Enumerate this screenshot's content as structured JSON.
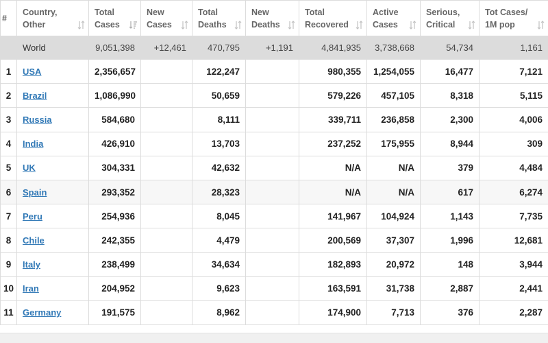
{
  "columns": [
    {
      "label": "#",
      "sortable": false
    },
    {
      "label": "Country,\nOther",
      "sortable": true
    },
    {
      "label": "Total\nCases",
      "sortable": true,
      "active": true
    },
    {
      "label": "New\nCases",
      "sortable": true
    },
    {
      "label": "Total\nDeaths",
      "sortable": true
    },
    {
      "label": "New\nDeaths",
      "sortable": true
    },
    {
      "label": "Total\nRecovered",
      "sortable": true
    },
    {
      "label": "Active\nCases",
      "sortable": true
    },
    {
      "label": "Serious,\nCritical",
      "sortable": true
    },
    {
      "label": "Tot Cases/\n1M pop",
      "sortable": true
    }
  ],
  "world": {
    "country": "World",
    "total_cases": "9,051,398",
    "new_cases": "+12,461",
    "total_deaths": "470,795",
    "new_deaths": "+1,191",
    "total_recovered": "4,841,935",
    "active_cases": "3,738,668",
    "serious_critical": "54,734",
    "cases_per_1m": "1,161"
  },
  "rows": [
    {
      "index": "1",
      "country": "USA",
      "total_cases": "2,356,657",
      "new_cases": "",
      "total_deaths": "122,247",
      "new_deaths": "",
      "total_recovered": "980,355",
      "active_cases": "1,254,055",
      "serious_critical": "16,477",
      "cases_per_1m": "7,121"
    },
    {
      "index": "2",
      "country": "Brazil",
      "total_cases": "1,086,990",
      "new_cases": "",
      "total_deaths": "50,659",
      "new_deaths": "",
      "total_recovered": "579,226",
      "active_cases": "457,105",
      "serious_critical": "8,318",
      "cases_per_1m": "5,115"
    },
    {
      "index": "3",
      "country": "Russia",
      "total_cases": "584,680",
      "new_cases": "",
      "total_deaths": "8,111",
      "new_deaths": "",
      "total_recovered": "339,711",
      "active_cases": "236,858",
      "serious_critical": "2,300",
      "cases_per_1m": "4,006"
    },
    {
      "index": "4",
      "country": "India",
      "total_cases": "426,910",
      "new_cases": "",
      "total_deaths": "13,703",
      "new_deaths": "",
      "total_recovered": "237,252",
      "active_cases": "175,955",
      "serious_critical": "8,944",
      "cases_per_1m": "309"
    },
    {
      "index": "5",
      "country": "UK",
      "total_cases": "304,331",
      "new_cases": "",
      "total_deaths": "42,632",
      "new_deaths": "",
      "total_recovered": "N/A",
      "active_cases": "N/A",
      "serious_critical": "379",
      "cases_per_1m": "4,484"
    },
    {
      "index": "6",
      "country": "Spain",
      "total_cases": "293,352",
      "new_cases": "",
      "total_deaths": "28,323",
      "new_deaths": "",
      "total_recovered": "N/A",
      "active_cases": "N/A",
      "serious_critical": "617",
      "cases_per_1m": "6,274"
    },
    {
      "index": "7",
      "country": "Peru",
      "total_cases": "254,936",
      "new_cases": "",
      "total_deaths": "8,045",
      "new_deaths": "",
      "total_recovered": "141,967",
      "active_cases": "104,924",
      "serious_critical": "1,143",
      "cases_per_1m": "7,735"
    },
    {
      "index": "8",
      "country": "Chile",
      "total_cases": "242,355",
      "new_cases": "",
      "total_deaths": "4,479",
      "new_deaths": "",
      "total_recovered": "200,569",
      "active_cases": "37,307",
      "serious_critical": "1,996",
      "cases_per_1m": "12,681"
    },
    {
      "index": "9",
      "country": "Italy",
      "total_cases": "238,499",
      "new_cases": "",
      "total_deaths": "34,634",
      "new_deaths": "",
      "total_recovered": "182,893",
      "active_cases": "20,972",
      "serious_critical": "148",
      "cases_per_1m": "3,944"
    },
    {
      "index": "10",
      "country": "Iran",
      "total_cases": "204,952",
      "new_cases": "",
      "total_deaths": "9,623",
      "new_deaths": "",
      "total_recovered": "163,591",
      "active_cases": "31,738",
      "serious_critical": "2,887",
      "cases_per_1m": "2,441"
    },
    {
      "index": "11",
      "country": "Germany",
      "total_cases": "191,575",
      "new_cases": "",
      "total_deaths": "8,962",
      "new_deaths": "",
      "total_recovered": "174,900",
      "active_cases": "7,713",
      "serious_critical": "376",
      "cases_per_1m": "2,287"
    }
  ],
  "colors": {
    "link": "#337ab7",
    "world_row": "#dcdcdc",
    "border": "#dcdcdc",
    "header_text": "#666666"
  },
  "icons": {
    "sort": "sort-arrows-icon",
    "sort_active": "sort-descending-icon"
  }
}
